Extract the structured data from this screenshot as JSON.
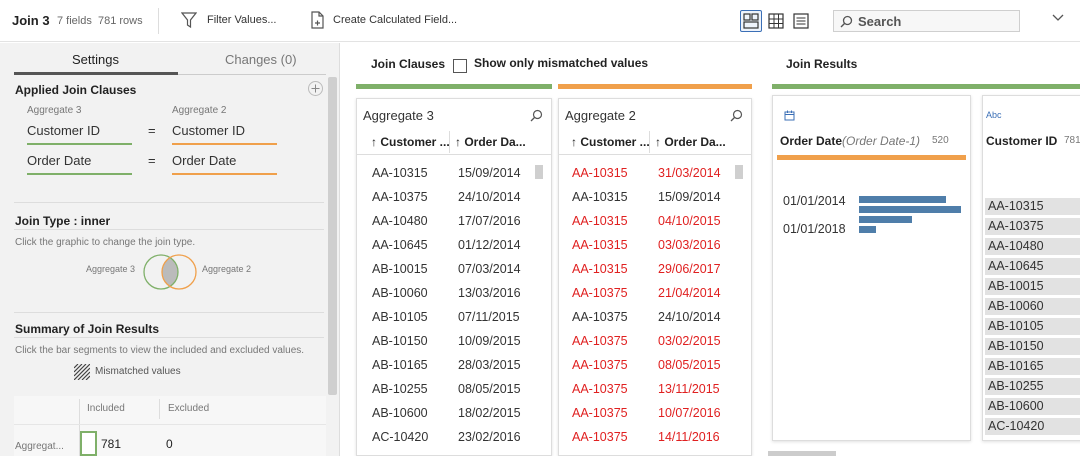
{
  "toolbar": {
    "title": "Join 3",
    "fields": "7 fields",
    "rows": "781 rows",
    "filter_label": "Filter Values...",
    "calc_label": "Create Calculated Field...",
    "search_placeholder": "Search"
  },
  "settings": {
    "tab_settings": "Settings",
    "tab_changes": "Changes (0)",
    "applied_title": "Applied Join Clauses",
    "left_source": "Aggregate 3",
    "right_source": "Aggregate 2",
    "clauses": [
      {
        "left": "Customer ID",
        "op": "=",
        "right": "Customer ID"
      },
      {
        "left": "Order Date",
        "op": "=",
        "right": "Order Date"
      }
    ],
    "join_type_title": "Join Type : inner",
    "join_type_hint": "Click the graphic to change the join type.",
    "venn_left": "Aggregate 3",
    "venn_right": "Aggregate 2",
    "summary_title": "Summary of Join Results",
    "summary_hint": "Click the bar segments to view the included and excluded values.",
    "mismatched_legend": "Mismatched values",
    "col_included": "Included",
    "col_excluded": "Excluded",
    "row_name": "Aggregat...",
    "row_included": "781",
    "row_excluded": "0"
  },
  "join_clauses": {
    "title": "Join Clauses",
    "mismatch_label": "Show only mismatched values",
    "left_card": {
      "title": "Aggregate 3",
      "col1": "↑ Customer ...",
      "col2": "↑ Order Da...",
      "rows": [
        {
          "id": "AA-10315",
          "date": "15/09/2014",
          "mismatch": false
        },
        {
          "id": "AA-10375",
          "date": "24/10/2014",
          "mismatch": false
        },
        {
          "id": "AA-10480",
          "date": "17/07/2016",
          "mismatch": false
        },
        {
          "id": "AA-10645",
          "date": "01/12/2014",
          "mismatch": false
        },
        {
          "id": "AB-10015",
          "date": "07/03/2014",
          "mismatch": false
        },
        {
          "id": "AB-10060",
          "date": "13/03/2016",
          "mismatch": false
        },
        {
          "id": "AB-10105",
          "date": "07/11/2015",
          "mismatch": false
        },
        {
          "id": "AB-10150",
          "date": "10/09/2015",
          "mismatch": false
        },
        {
          "id": "AB-10165",
          "date": "28/03/2015",
          "mismatch": false
        },
        {
          "id": "AB-10255",
          "date": "08/05/2015",
          "mismatch": false
        },
        {
          "id": "AB-10600",
          "date": "18/02/2015",
          "mismatch": false
        },
        {
          "id": "AC-10420",
          "date": "23/02/2016",
          "mismatch": false
        }
      ]
    },
    "right_card": {
      "title": "Aggregate 2",
      "col1": "↑ Customer ...",
      "col2": "↑ Order Da...",
      "rows": [
        {
          "id": "AA-10315",
          "date": "31/03/2014",
          "mismatch": true
        },
        {
          "id": "AA-10315",
          "date": "15/09/2014",
          "mismatch": false
        },
        {
          "id": "AA-10315",
          "date": "04/10/2015",
          "mismatch": true
        },
        {
          "id": "AA-10315",
          "date": "03/03/2016",
          "mismatch": true
        },
        {
          "id": "AA-10315",
          "date": "29/06/2017",
          "mismatch": true
        },
        {
          "id": "AA-10375",
          "date": "21/04/2014",
          "mismatch": true
        },
        {
          "id": "AA-10375",
          "date": "24/10/2014",
          "mismatch": false
        },
        {
          "id": "AA-10375",
          "date": "03/02/2015",
          "mismatch": true
        },
        {
          "id": "AA-10375",
          "date": "08/05/2015",
          "mismatch": true
        },
        {
          "id": "AA-10375",
          "date": "13/11/2015",
          "mismatch": true
        },
        {
          "id": "AA-10375",
          "date": "10/07/2016",
          "mismatch": true
        },
        {
          "id": "AA-10375",
          "date": "14/11/2016",
          "mismatch": true
        }
      ]
    }
  },
  "join_results": {
    "title": "Join Results",
    "order_card": {
      "type_icon": "calendar-icon",
      "field": "Order Date",
      "alias": "(Order Date-1)",
      "count": "520",
      "hist_labels": [
        "01/01/2014",
        "01/01/2018"
      ],
      "bins": [
        0.85,
        1.0,
        0.52,
        0.17
      ]
    },
    "customer_card": {
      "type_icon": "Abc",
      "field": "Customer ID",
      "count": "781",
      "values": [
        "AA-10315",
        "AA-10375",
        "AA-10480",
        "AA-10645",
        "AB-10015",
        "AB-10060",
        "AB-10105",
        "AB-10150",
        "AB-10165",
        "AB-10255",
        "AB-10600",
        "AC-10420"
      ]
    }
  },
  "colors": {
    "left_accent": "#7fb069",
    "right_accent": "#f0a04b",
    "mismatch": "#e02020",
    "bar": "#4f7eaa"
  }
}
